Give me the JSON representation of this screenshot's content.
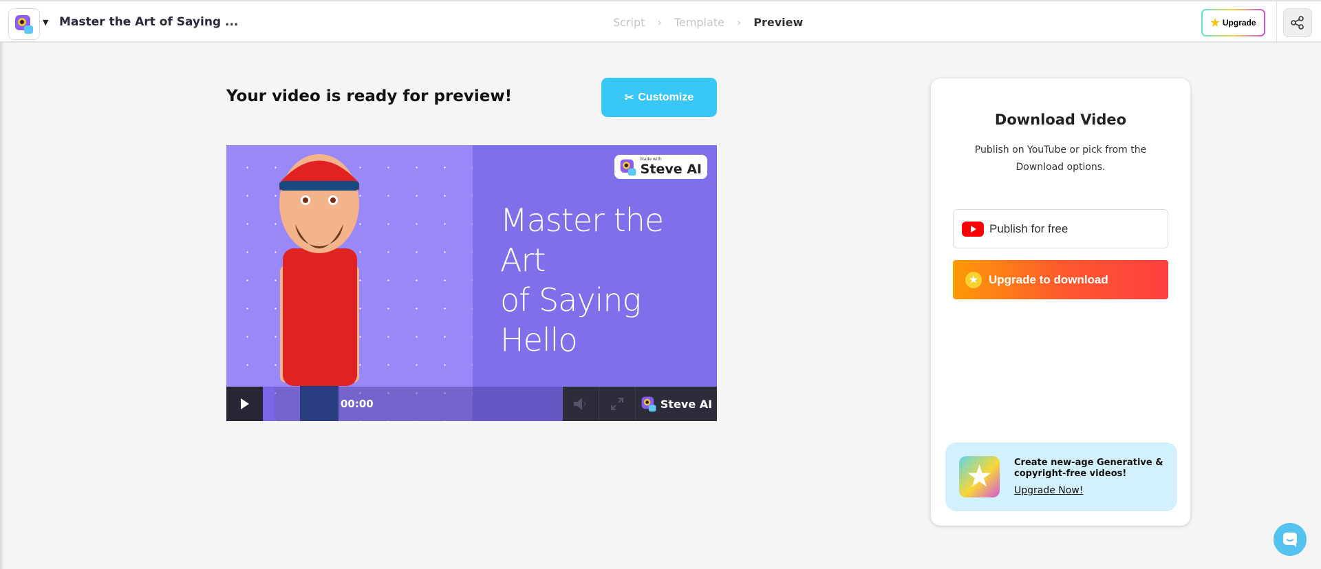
{
  "header": {
    "project_title": "Master the Art of Saying ...",
    "breadcrumb": [
      "Script",
      "Template",
      "Preview"
    ],
    "upgrade_label": "Upgrade"
  },
  "main": {
    "heading": "Your video is ready for preview!",
    "customize_label": "Customize"
  },
  "video": {
    "title_line1": "Master the Art",
    "title_line2": "of Saying Hello",
    "badge_small": "Made with",
    "badge_brand": "Steve AI",
    "time": "00:00",
    "progress": 0,
    "brand": "Steve AI"
  },
  "download": {
    "title": "Download Video",
    "subtitle": "Publish on YouTube or pick from the Download options.",
    "publish_label": "Publish for free",
    "upgrade_download_label": "Upgrade to download"
  },
  "promo": {
    "text": "Create new-age Generative & copyright-free videos!",
    "link": "Upgrade Now!"
  },
  "colors": {
    "accent": "#38c6f4",
    "video_bg": "#7e70ea",
    "promo_bg": "#d3f1fc"
  }
}
